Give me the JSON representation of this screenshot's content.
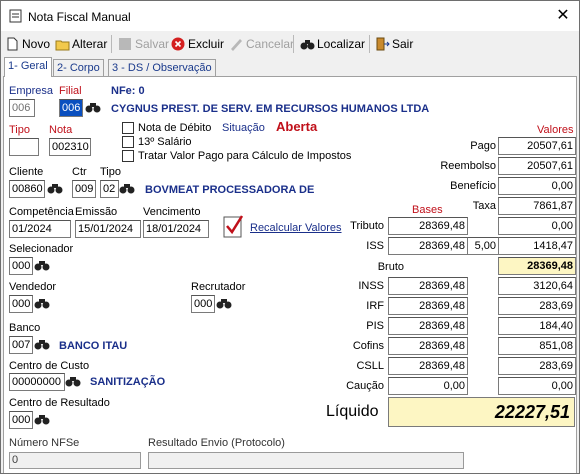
{
  "window": {
    "title": "Nota Fiscal Manual"
  },
  "toolbar": {
    "novo": "Novo",
    "alterar": "Alterar",
    "salvar": "Salvar",
    "excluir": "Excluir",
    "cancelar": "Cancelar",
    "localizar": "Localizar",
    "sair": "Sair"
  },
  "tabs": [
    "1- Geral",
    "2- Corpo",
    "3 - DS / Observação"
  ],
  "empresa": {
    "label": "Empresa",
    "value": "006"
  },
  "filial": {
    "label": "Filial",
    "value": "006"
  },
  "nfe": "NFe: 0",
  "empresa_nome": "CYGNUS PREST. DE SERV. EM RECURSOS HUMANOS LTDA",
  "tipo": {
    "label": "Tipo",
    "value": ""
  },
  "nota": {
    "label": "Nota",
    "value": "002310"
  },
  "checks": {
    "nota_debito": "Nota de Débito",
    "decimo": "13º Salário",
    "tratar": "Tratar Valor Pago para Cálculo de Impostos"
  },
  "situacao": {
    "label": "Situação",
    "value": "Aberta"
  },
  "cliente": {
    "label": "Cliente",
    "value": "00860",
    "nome": "BOVMEAT PROCESSADORA DE"
  },
  "ctr": {
    "label": "Ctr",
    "value": "009"
  },
  "tipo2": {
    "label": "Tipo",
    "value": "02"
  },
  "competencia": {
    "label": "Competência",
    "value": "01/2024"
  },
  "emissao": {
    "label": "Emissão",
    "value": "15/01/2024"
  },
  "vencimento": {
    "label": "Vencimento",
    "value": "18/01/2024"
  },
  "recalcular": "Recalcular Valores",
  "selecionador": {
    "label": "Selecionador",
    "value": "000"
  },
  "vendedor": {
    "label": "Vendedor",
    "value": "000"
  },
  "recrutador": {
    "label": "Recrutador",
    "value": "000"
  },
  "banco": {
    "label": "Banco",
    "value": "007",
    "nome": "BANCO ITAU"
  },
  "centro_custo": {
    "label": "Centro de Custo",
    "value": "00000000",
    "nome": "SANITIZAÇÃO"
  },
  "centro_resultado": {
    "label": "Centro de Resultado",
    "value": "000"
  },
  "numero_nfse": {
    "label": "Número NFSe",
    "value": "0"
  },
  "resultado_envio": {
    "label": "Resultado Envio (Protocolo)",
    "value": ""
  },
  "valores_header": "Valores",
  "bases_header": "Bases",
  "pago": {
    "label": "Pago",
    "value": "20507,61"
  },
  "reembolso": {
    "label": "Reembolso",
    "value": "20507,61"
  },
  "beneficio": {
    "label": "Benefício",
    "value": "0,00"
  },
  "taxa": {
    "label": "Taxa",
    "value": "7861,87"
  },
  "tributo": {
    "label": "Tributo",
    "base": "28369,48",
    "value": "0,00"
  },
  "iss": {
    "label": "ISS",
    "base": "28369,48",
    "aliquota": "5,00",
    "value": "1418,47"
  },
  "bruto": {
    "label": "Bruto",
    "value": "28369,48"
  },
  "inss": {
    "label": "INSS",
    "base": "28369,48",
    "value": "3120,64"
  },
  "irf": {
    "label": "IRF",
    "base": "28369,48",
    "value": "283,69"
  },
  "pis": {
    "label": "PIS",
    "base": "28369,48",
    "value": "184,40"
  },
  "cofins": {
    "label": "Cofins",
    "base": "28369,48",
    "value": "851,08"
  },
  "csll": {
    "label": "CSLL",
    "base": "28369,48",
    "value": "283,69"
  },
  "caucao": {
    "label": "Caução",
    "base": "0,00",
    "value": "0,00"
  },
  "liquido": {
    "label": "Líquido",
    "value": "22227,51"
  },
  "colors": {
    "label_red": "#c0101a",
    "label_blue": "#1a2f8a",
    "selected": "#0a4fbf",
    "bruto_bg": "#fdf6c3"
  }
}
